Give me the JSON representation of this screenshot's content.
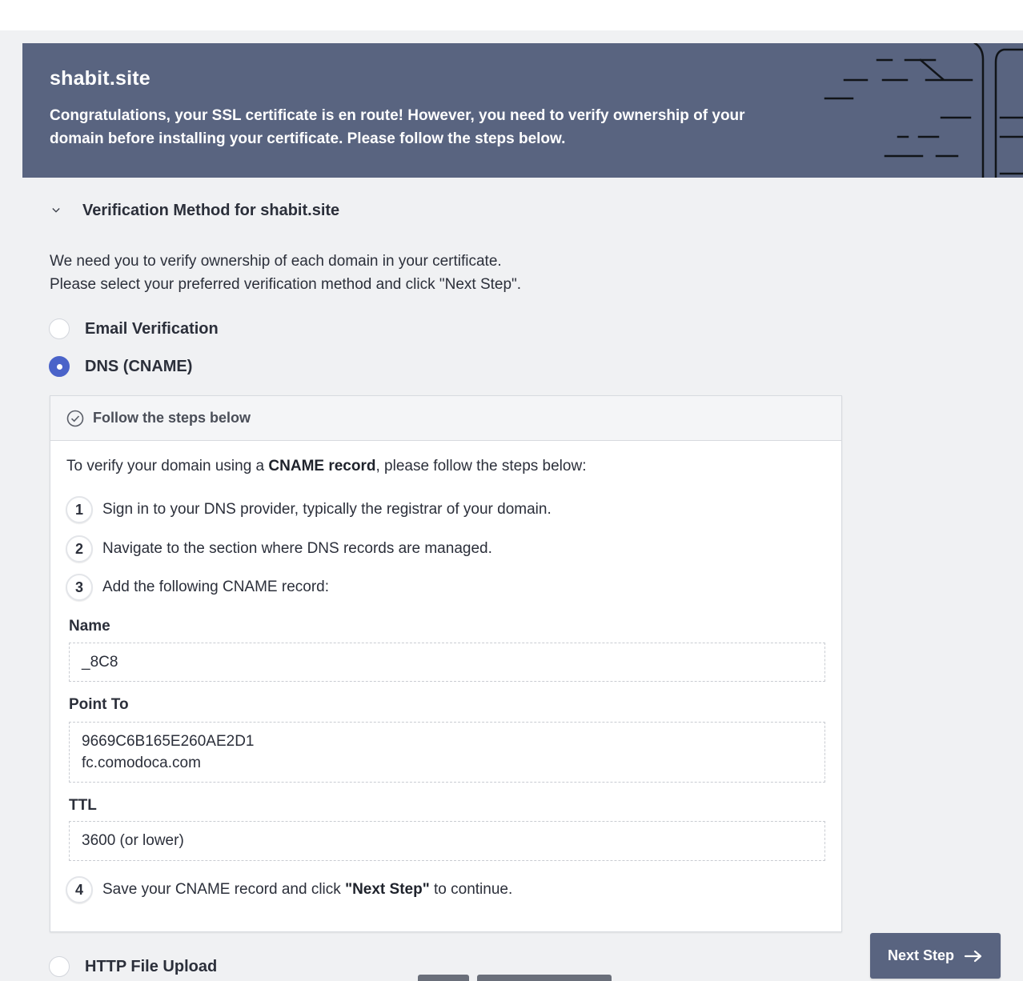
{
  "banner": {
    "domain": "shabit.site",
    "message": "Congratulations, your SSL certificate is en route! However, you need to verify ownership of your domain before installing your certificate. Please follow the steps below."
  },
  "section": {
    "title": "Verification Method for shabit.site",
    "intro_line1": "We need you to verify ownership of each domain in your certificate.",
    "intro_line2": "Please select your preferred verification method and click \"Next Step\"."
  },
  "methods": {
    "email": "Email Verification",
    "dns": "DNS (CNAME)",
    "http": "HTTP File Upload",
    "selected": "DNS (CNAME)"
  },
  "steps_box": {
    "header": "Follow the steps below",
    "intro_prefix": "To verify your domain using a ",
    "intro_bold": "CNAME record",
    "intro_suffix": ", please follow the steps below:",
    "step1_num": "1",
    "step1": "Sign in to your DNS provider, typically the registrar of your domain.",
    "step2_num": "2",
    "step2": "Navigate to the section where DNS records are managed.",
    "step3_num": "3",
    "step3": "Add the following CNAME record:",
    "step4_num": "4",
    "step4_prefix": "Save your CNAME record and click ",
    "step4_bold": "\"Next Step\"",
    "step4_suffix": " to continue."
  },
  "record": {
    "name_label": "Name",
    "name_value": "_8C8",
    "point_label": "Point To",
    "point_line1": "9669C6B165E260AE2D1",
    "point_line2": "fc.comodoca.com",
    "ttl_label": "TTL",
    "ttl_value": "3600 (or lower)"
  },
  "next_button": {
    "label": "Next Step",
    "icon": "arrow-right-icon"
  },
  "colors": {
    "banner_bg": "#596480",
    "radio_selected": "#4a63c9",
    "page_bg": "#f0f1f3"
  }
}
